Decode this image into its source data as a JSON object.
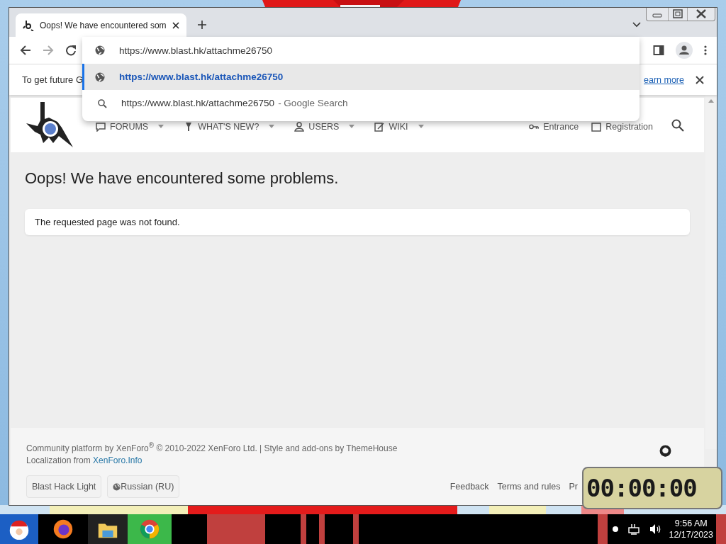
{
  "browser": {
    "tab": {
      "title": "Oops! We have encountered som"
    },
    "omnibox": {
      "value": "https://www.blast.hk/attachme26750"
    },
    "suggestions": [
      {
        "kind": "url",
        "text": "https://www.blast.hk/attachme26750",
        "selected": true
      },
      {
        "kind": "search",
        "text": "https://www.blast.hk/attachme26750",
        "suffix": "- Google Search",
        "selected": false
      }
    ],
    "infobar": {
      "text": "To get future G",
      "link": "earn more"
    }
  },
  "site": {
    "nav": [
      {
        "kind": "forums",
        "label": "FORUMS"
      },
      {
        "kind": "new",
        "label": "WHAT'S NEW?"
      },
      {
        "kind": "users",
        "label": "USERS"
      },
      {
        "kind": "wiki",
        "label": "WIKI"
      }
    ],
    "account": [
      {
        "kind": "login",
        "label": "Entrance"
      },
      {
        "kind": "register",
        "label": "Registration"
      }
    ],
    "title": "Oops! We have encountered some problems.",
    "message": "The requested page was not found.",
    "footer": {
      "credit": "Community platform by XenForo$^{®}$ © 2010-2022 XenForo Ltd. | Style and add-ons by ThemeHouse",
      "localization": "Localization from",
      "localization_link": "XenForo.Info",
      "buttons": [
        {
          "kind": "style",
          "label": "Blast Hack Light"
        },
        {
          "kind": "language",
          "label": "Russian (RU)"
        }
      ],
      "links": [
        "Feedback",
        "Terms and rules",
        "Pr"
      ]
    }
  },
  "timer": {
    "display": "00:00:00"
  },
  "taskbar": {
    "time": "9:56 AM",
    "date": "12/17/2023"
  }
}
